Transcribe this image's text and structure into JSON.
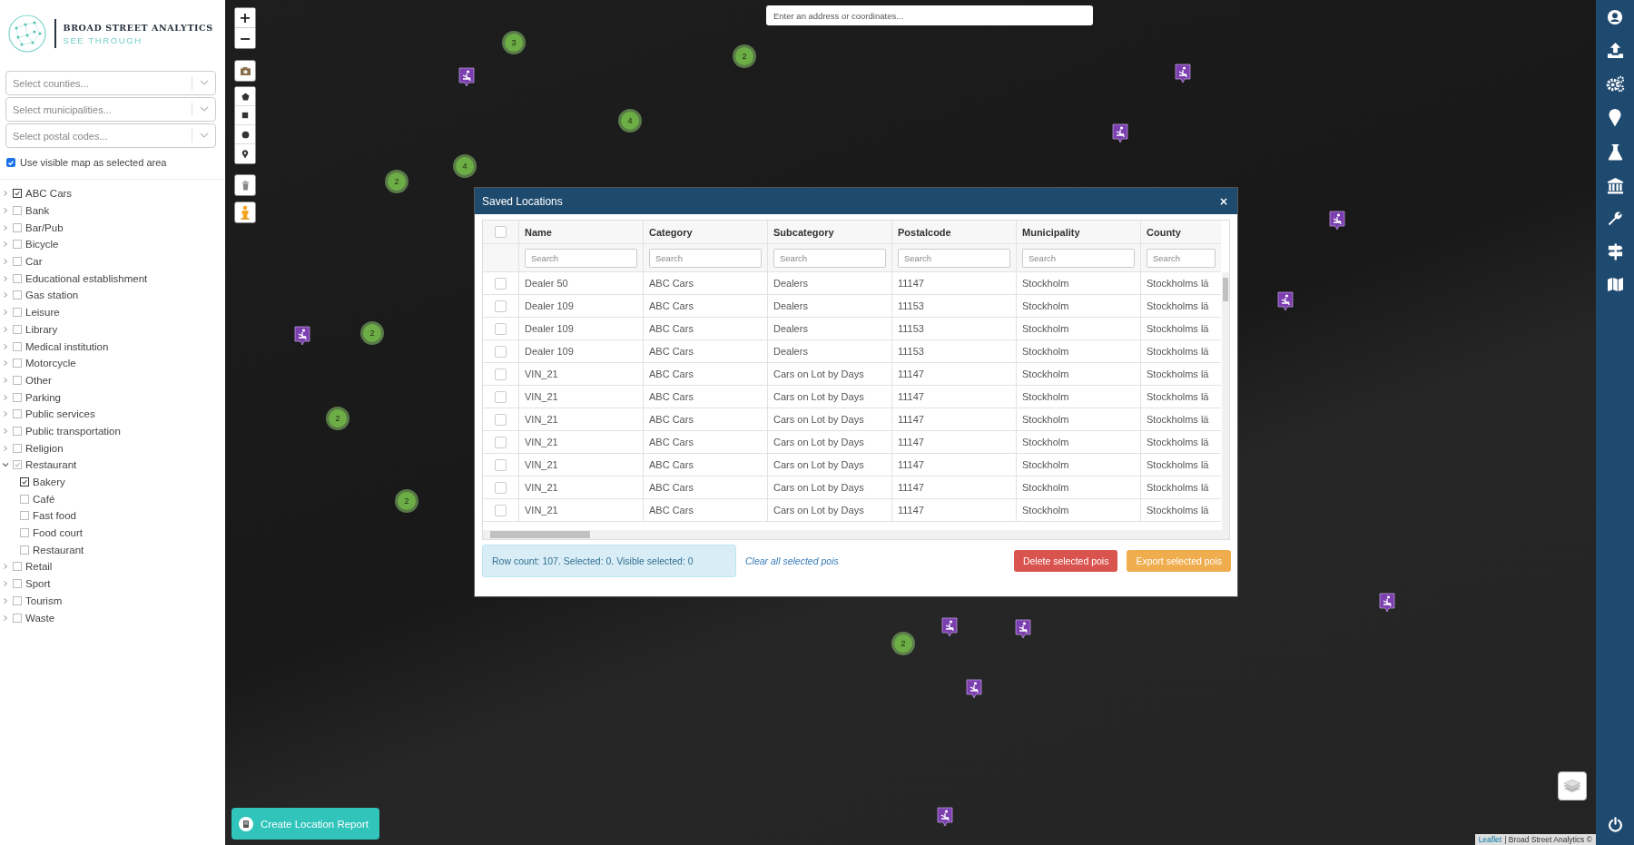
{
  "brand": {
    "name": "BROAD STREET ANALYTICS",
    "tagline": "SEE THROUGH"
  },
  "filters": [
    {
      "placeholder": "Select counties..."
    },
    {
      "placeholder": "Select municipalities..."
    },
    {
      "placeholder": "Select postal codes..."
    }
  ],
  "visible_area": {
    "label": "Use visible map as selected area",
    "checked": true
  },
  "categories": [
    {
      "label": "ABC Cars",
      "checked": true,
      "partial": false,
      "expanded": false
    },
    {
      "label": "Bank",
      "checked": false,
      "partial": false,
      "expanded": false
    },
    {
      "label": "Bar/Pub",
      "checked": false,
      "partial": false,
      "expanded": false
    },
    {
      "label": "Bicycle",
      "checked": false,
      "partial": false,
      "expanded": false
    },
    {
      "label": "Car",
      "checked": false,
      "partial": false,
      "expanded": false
    },
    {
      "label": "Educational establishment",
      "checked": false,
      "partial": false,
      "expanded": false
    },
    {
      "label": "Gas station",
      "checked": false,
      "partial": false,
      "expanded": false
    },
    {
      "label": "Leisure",
      "checked": false,
      "partial": false,
      "expanded": false
    },
    {
      "label": "Library",
      "checked": false,
      "partial": false,
      "expanded": false
    },
    {
      "label": "Medical institution",
      "checked": false,
      "partial": false,
      "expanded": false
    },
    {
      "label": "Motorcycle",
      "checked": false,
      "partial": false,
      "expanded": false
    },
    {
      "label": "Other",
      "checked": false,
      "partial": false,
      "expanded": false
    },
    {
      "label": "Parking",
      "checked": false,
      "partial": false,
      "expanded": false
    },
    {
      "label": "Public services",
      "checked": false,
      "partial": false,
      "expanded": false
    },
    {
      "label": "Public transportation",
      "checked": false,
      "partial": false,
      "expanded": false
    },
    {
      "label": "Religion",
      "checked": false,
      "partial": false,
      "expanded": false
    },
    {
      "label": "Restaurant",
      "partial": true,
      "expanded": true,
      "children": [
        {
          "label": "Bakery",
          "checked": true,
          "partial": false
        },
        {
          "label": "Café",
          "checked": false,
          "partial": false
        },
        {
          "label": "Fast food",
          "checked": false,
          "partial": false
        },
        {
          "label": "Food court",
          "checked": false,
          "partial": false
        },
        {
          "label": "Restaurant",
          "checked": false,
          "partial": false
        }
      ]
    },
    {
      "label": "Retail",
      "checked": false,
      "partial": false,
      "expanded": false
    },
    {
      "label": "Sport",
      "checked": false,
      "partial": false,
      "expanded": false
    },
    {
      "label": "Tourism",
      "checked": false,
      "partial": false,
      "expanded": false
    },
    {
      "label": "Waste",
      "checked": false,
      "partial": false,
      "expanded": false
    }
  ],
  "map": {
    "search": {
      "placeholder": "Enter an address or coordinates..."
    },
    "zoom_in": "+",
    "zoom_out": "−",
    "clusters": [
      {
        "count": "3"
      },
      {
        "count": "2"
      },
      {
        "count": "4"
      },
      {
        "count": "2"
      },
      {
        "count": "4"
      },
      {
        "count": "2"
      },
      {
        "count": "2"
      },
      {
        "count": "2"
      },
      {
        "count": "2"
      }
    ],
    "report_button": "Create Location Report",
    "attribution": {
      "link": "Leaflet",
      "text": "| Broad Street Analytics ©"
    }
  },
  "dialog": {
    "title": "Saved Locations",
    "close": "×",
    "select_all": {
      "checked": false
    },
    "columns": [
      {
        "label": "Name",
        "search_placeholder": "Search"
      },
      {
        "label": "Category",
        "search_placeholder": "Search"
      },
      {
        "label": "Subcategory",
        "search_placeholder": "Search"
      },
      {
        "label": "Postalcode",
        "search_placeholder": "Search"
      },
      {
        "label": "Municipality",
        "search_placeholder": "Search"
      },
      {
        "label": "County",
        "search_placeholder": "Search"
      }
    ],
    "rows": [
      {
        "selected": false,
        "cells": [
          "Dealer 50",
          "ABC Cars",
          "Dealers",
          "11147",
          "Stockholm",
          "Stockholms lä"
        ]
      },
      {
        "selected": false,
        "cells": [
          "Dealer 109",
          "ABC Cars",
          "Dealers",
          "11153",
          "Stockholm",
          "Stockholms lä"
        ]
      },
      {
        "selected": false,
        "cells": [
          "Dealer 109",
          "ABC Cars",
          "Dealers",
          "11153",
          "Stockholm",
          "Stockholms lä"
        ]
      },
      {
        "selected": false,
        "cells": [
          "Dealer 109",
          "ABC Cars",
          "Dealers",
          "11153",
          "Stockholm",
          "Stockholms lä"
        ]
      },
      {
        "selected": false,
        "cells": [
          "VIN_21",
          "ABC Cars",
          "Cars on Lot by Days",
          "11147",
          "Stockholm",
          "Stockholms lä"
        ]
      },
      {
        "selected": false,
        "cells": [
          "VIN_21",
          "ABC Cars",
          "Cars on Lot by Days",
          "11147",
          "Stockholm",
          "Stockholms lä"
        ]
      },
      {
        "selected": false,
        "cells": [
          "VIN_21",
          "ABC Cars",
          "Cars on Lot by Days",
          "11147",
          "Stockholm",
          "Stockholms lä"
        ]
      },
      {
        "selected": false,
        "cells": [
          "VIN_21",
          "ABC Cars",
          "Cars on Lot by Days",
          "11147",
          "Stockholm",
          "Stockholms lä"
        ]
      },
      {
        "selected": false,
        "cells": [
          "VIN_21",
          "ABC Cars",
          "Cars on Lot by Days",
          "11147",
          "Stockholm",
          "Stockholms lä"
        ]
      },
      {
        "selected": false,
        "cells": [
          "VIN_21",
          "ABC Cars",
          "Cars on Lot by Days",
          "11147",
          "Stockholm",
          "Stockholms lä"
        ]
      },
      {
        "selected": false,
        "cells": [
          "VIN_21",
          "ABC Cars",
          "Cars on Lot by Days",
          "11147",
          "Stockholm",
          "Stockholms lä"
        ]
      }
    ],
    "status": "Row count: 107. Selected: 0. Visible selected: 0",
    "clear_link": "Clear all selected pois",
    "delete_button": "Delete selected pois",
    "export_button": "Export selected pois"
  }
}
